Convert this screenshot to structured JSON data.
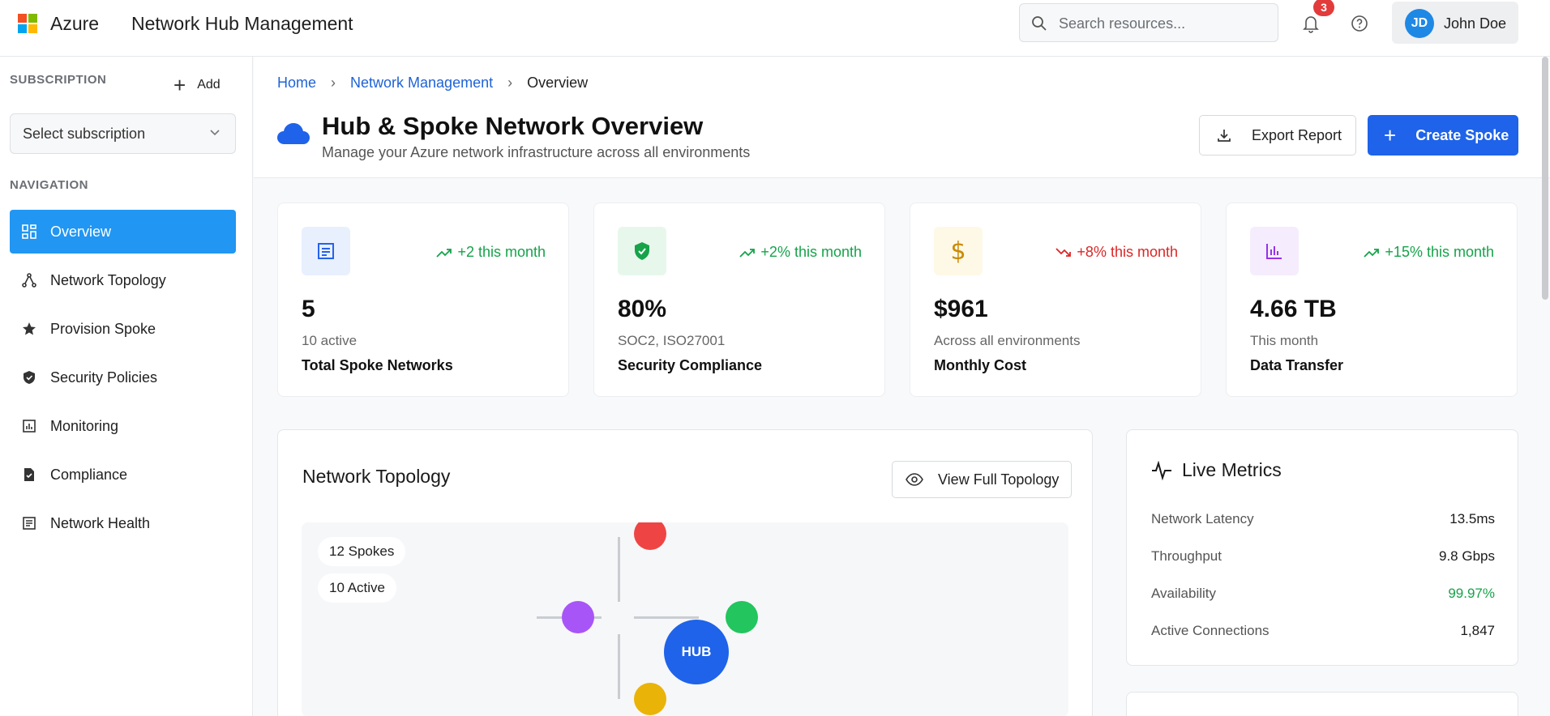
{
  "header": {
    "brand": "Azure",
    "app_title": "Network Hub Management",
    "search_placeholder": "Search resources...",
    "notification_count": "3",
    "user": {
      "initials": "JD",
      "name": "John Doe"
    }
  },
  "sidebar": {
    "subscription_label": "SUBSCRIPTION",
    "add_label": "Add",
    "subscription_select": "Select subscription",
    "navigation_label": "NAVIGATION",
    "items": [
      {
        "label": "Overview",
        "icon": "grid-icon",
        "active": true
      },
      {
        "label": "Network Topology",
        "icon": "topology-icon",
        "active": false
      },
      {
        "label": "Provision Spoke",
        "icon": "star-icon",
        "active": false
      },
      {
        "label": "Security Policies",
        "icon": "shield-icon",
        "active": false
      },
      {
        "label": "Monitoring",
        "icon": "chart-icon",
        "active": false
      },
      {
        "label": "Compliance",
        "icon": "document-check-icon",
        "active": false
      },
      {
        "label": "Network Health",
        "icon": "list-icon",
        "active": false
      }
    ]
  },
  "page": {
    "breadcrumbs": [
      "Home",
      "Network Management",
      "Overview"
    ],
    "title": "Hub & Spoke Network Overview",
    "subtitle": "Manage your Azure network infrastructure across all environments",
    "export_label": "Export Report",
    "create_label": "Create Spoke"
  },
  "stats": [
    {
      "trend": "+2 this month",
      "trend_dir": "up",
      "value": "5",
      "sub": "10 active",
      "label": "Total Spoke Networks",
      "icon": "document-icon",
      "color": "#2563eb",
      "bg": "#e8f0fe"
    },
    {
      "trend": "+2% this month",
      "trend_dir": "up",
      "value": "80%",
      "sub": "SOC2, ISO27001",
      "label": "Security Compliance",
      "icon": "shield-check-icon",
      "color": "#16a34a",
      "bg": "#e7f7ec"
    },
    {
      "trend": "+8% this month",
      "trend_dir": "down",
      "value": "$961",
      "sub": "Across all environments",
      "label": "Monthly Cost",
      "icon": "dollar-icon",
      "color": "#ca8a04",
      "bg": "#fef8e6"
    },
    {
      "trend": "+15% this month",
      "trend_dir": "up",
      "value": "4.66 TB",
      "sub": "This month",
      "label": "Data Transfer",
      "icon": "bar-chart-icon",
      "color": "#9333ea",
      "bg": "#f5ecfd"
    }
  ],
  "topology": {
    "title": "Network Topology",
    "view_label": "View Full Topology",
    "spokes_pill": "12 Spokes",
    "active_pill": "10 Active",
    "hub_label": "HUB",
    "node_colors": {
      "red": "#ef4444",
      "purple": "#a855f7",
      "green": "#22c55e",
      "yellow": "#eab308",
      "hub": "#1e63e9"
    }
  },
  "metrics": {
    "title": "Live Metrics",
    "rows": [
      {
        "label": "Network Latency",
        "value": "13.5ms",
        "status": "normal"
      },
      {
        "label": "Throughput",
        "value": "9.8 Gbps",
        "status": "normal"
      },
      {
        "label": "Availability",
        "value": "99.97%",
        "status": "good"
      },
      {
        "label": "Active Connections",
        "value": "1,847",
        "status": "normal"
      }
    ]
  }
}
